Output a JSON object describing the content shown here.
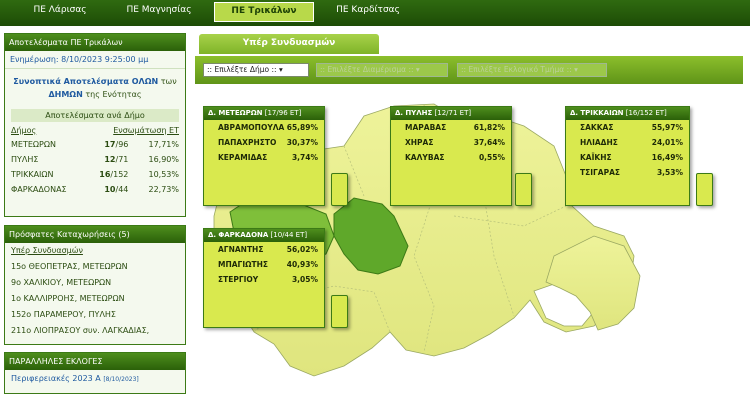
{
  "nav": {
    "tabs": [
      {
        "label": "ΠΕ Λάρισας"
      },
      {
        "label": "ΠΕ Μαγνησίας"
      },
      {
        "label": "ΠΕ Τρικάλων"
      },
      {
        "label": "ΠΕ Καρδίτσας"
      }
    ],
    "active_index": 2
  },
  "results_panel": {
    "header": "Αποτελέσματα ΠΕ Τρικάλων",
    "update": "Ενημέρωση: 8/10/2023 9:25:00 μμ",
    "summary_link": "Συνοπτικά Αποτελέσματα ΟΛΩΝ",
    "summary_rest1": "των",
    "summary_link2": "ΔΗΜΩΝ",
    "summary_rest2": "της Ενότητας",
    "by_municipality_title": "Αποτελέσματα ανά Δήμο",
    "columns": {
      "municipality": "Δήμος",
      "integration": "Ενσωμάτωση ΕΤ"
    },
    "rows": [
      {
        "name": "ΜΕΤΕΩΡΩΝ",
        "done": "17",
        "total": "/96",
        "pct": "17,71%"
      },
      {
        "name": "ΠΥΛΗΣ",
        "done": "12",
        "total": "/71",
        "pct": "16,90%"
      },
      {
        "name": "ΤΡΙΚΚΑΙΩΝ",
        "done": "16",
        "total": "/152",
        "pct": "10,53%"
      },
      {
        "name": "ΦΑΡΚΑΔΟΝΑΣ",
        "done": "10",
        "total": "/44",
        "pct": "22,73%"
      }
    ]
  },
  "recent_panel": {
    "header": "Πρόσφατες Καταχωρήσεις (5)",
    "items": [
      {
        "text": "Υπέρ Συνδυασμών"
      },
      {
        "text": "15ο ΘΕΟΠΕΤΡΑΣ, ΜΕΤΕΩΡΩΝ"
      },
      {
        "text": "9ο ΧΑΛΙΚΙΟΥ, ΜΕΤΕΩΡΩΝ"
      },
      {
        "text": "1ο ΚΑΛΛΙΡΡΟΗΣ, ΜΕΤΕΩΡΩΝ"
      },
      {
        "text": "152ο ΠΑΡΑΜΕΡΟΥ, ΠΥΛΗΣ"
      },
      {
        "text": "211ο ΛΙΟΠΡΑΣΟΥ συν. ΛΑΓΚΑΔΙΑΣ,"
      }
    ]
  },
  "parallel_panel": {
    "header": "ΠΑΡΑΛΛΗΛΕΣ ΕΚΛΟΓΕΣ",
    "link": "Περιφερειακές 2023 Α",
    "link_date": "[8/10/2023]"
  },
  "main": {
    "tab_label": "Υπέρ Συνδυασμών",
    "selects": [
      {
        "value": ":: Επιλέξτε Δήμο ::",
        "arrow": "▾"
      },
      {
        "value": ":: Επιλέξτε Διαμέρισμα ::",
        "arrow": "▾"
      },
      {
        "value": ":: Επιλέξτε Εκλογικό Τμήμα ::",
        "arrow": "▾"
      }
    ]
  },
  "callouts": [
    {
      "prefix": "Δ.",
      "name": "ΜΕΤΕΩΡΩΝ",
      "count": "[17/96 ΕΤ]",
      "rows": [
        {
          "candidate": "ΑΒΡΑΜΟΠΟΥΛΑ",
          "pct": "65,89%"
        },
        {
          "candidate": "ΠΑΠΑΧΡΗΣΤΟ",
          "pct": "30,37%"
        },
        {
          "candidate": "ΚΕΡΑΜΙΔΑΣ",
          "pct": "3,74%"
        }
      ]
    },
    {
      "prefix": "Δ.",
      "name": "ΠΥΛΗΣ",
      "count": "[12/71 ΕΤ]",
      "rows": [
        {
          "candidate": "ΜΑΡΑΒΑΣ",
          "pct": "61,82%"
        },
        {
          "candidate": "ΧΗΡΑΣ",
          "pct": "37,64%"
        },
        {
          "candidate": "ΚΑΛΥΒΑΣ",
          "pct": "0,55%"
        }
      ]
    },
    {
      "prefix": "Δ.",
      "name": "ΤΡΙΚΚΑΙΩΝ",
      "count": "[16/152 ΕΤ]",
      "rows": [
        {
          "candidate": "ΣΑΚΚΑΣ",
          "pct": "55,97%"
        },
        {
          "candidate": "ΗΛΙΑΔΗΣ",
          "pct": "24,01%"
        },
        {
          "candidate": "ΚΑΪΚΗΣ",
          "pct": "16,49%"
        },
        {
          "candidate": "ΤΣΙΓΑΡΑΣ",
          "pct": "3,53%"
        }
      ]
    },
    {
      "prefix": "Δ.",
      "name": "ΦΑΡΚΑΔΟΝΑ",
      "count": "[10/44 ΕΤ]",
      "rows": [
        {
          "candidate": "ΑΓΝΑΝΤΗΣ",
          "pct": "56,02%"
        },
        {
          "candidate": "ΜΠΑΓΙΩΤΗΣ",
          "pct": "40,93%"
        },
        {
          "candidate": "ΣΤΕΡΓΙΟΥ",
          "pct": "3,05%"
        }
      ]
    }
  ],
  "colors": {
    "nav_bg": "#1d4c06",
    "active_tab": "#b8d94a",
    "map_fill": "#e6ec90",
    "highlight_region": "#5fa82a",
    "callout_bg": "#d9e94e",
    "link": "#1f5aa0"
  }
}
